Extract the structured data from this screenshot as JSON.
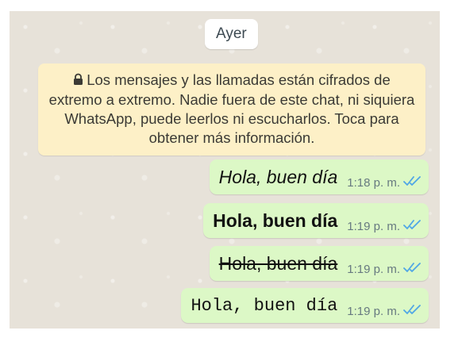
{
  "chat": {
    "date_label": "Ayer",
    "encryption_notice": "Los mensajes y las llamadas están cifrados de extremo a extremo. Nadie fuera de este chat, ni siquiera WhatsApp, puede leerlos ni escucharlos. Toca para obtener más información.",
    "messages": [
      {
        "text": "Hola, buen día",
        "time": "1:18 p. m.",
        "format": "italic",
        "status": "read"
      },
      {
        "text": "Hola, buen día",
        "time": "1:19 p. m.",
        "format": "bold",
        "status": "read"
      },
      {
        "text": "Hola, buen día",
        "time": "1:19 p. m.",
        "format": "strikethrough",
        "status": "read"
      },
      {
        "text": "Hola, buen día",
        "time": "1:19 p. m.",
        "format": "monospace",
        "status": "read"
      }
    ]
  },
  "colors": {
    "chat_background": "#e7e2d9",
    "outgoing_bubble": "#dcf8c6",
    "notice_background": "#fdf0c7",
    "read_ticks": "#4fa6e6"
  },
  "icons": [
    "lock-icon",
    "double-check-icon"
  ]
}
